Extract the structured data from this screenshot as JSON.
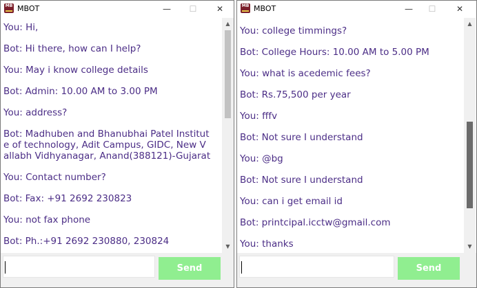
{
  "windows": [
    {
      "title": "MBOT",
      "icon": "mbot-app-icon",
      "icon_text": "MB",
      "controls": [
        "—",
        "☐",
        "✕"
      ],
      "messages": [
        "You: Hi,",
        "Bot: Hi there, how can I help?",
        "You: May i know college details",
        "Bot: Admin: 10.00 AM to 3.00 PM",
        "You: address?",
        "Bot: Madhuben and Bhanubhai Patel Institut",
        "e of technology, Adit Campus, GIDC, New V",
        "allabh Vidhyanagar, Anand(388121)-Gujarat",
        "You: Contact number?",
        "Bot: Fax: +91 2692 230823",
        "You: not fax phone",
        "Bot: Ph.:+91 2692 230880, 230824"
      ],
      "scroll_position": 0.0,
      "input_value": "",
      "send_label": "Send"
    },
    {
      "title": "MBOT",
      "icon": "mbot-app-icon",
      "icon_text": "MB",
      "controls": [
        "—",
        "☐",
        "✕"
      ],
      "messages": [
        "You: college timmings?",
        "Bot: College Hours: 10.00 AM to 5.00 PM",
        "You: what is acedemic fees?",
        "Bot: Rs.75,500 per year",
        "You: fffv",
        "Bot: Not sure I understand",
        "You: @bg",
        "Bot: Not sure I understand",
        "You: can i get email id",
        "Bot: printcipal.icctw@gmail.com",
        "You: thanks"
      ],
      "scroll_position": 1.0,
      "input_value": "",
      "send_label": "Send"
    }
  ],
  "colors": {
    "message_text": "#4b2d86",
    "send_button": "#90ee90",
    "send_text": "#ffffff",
    "scroll_thumb_left": "#c2c2c2",
    "scroll_thumb_right": "#6b6b6b",
    "icon_bg": "#7b1f2b"
  }
}
